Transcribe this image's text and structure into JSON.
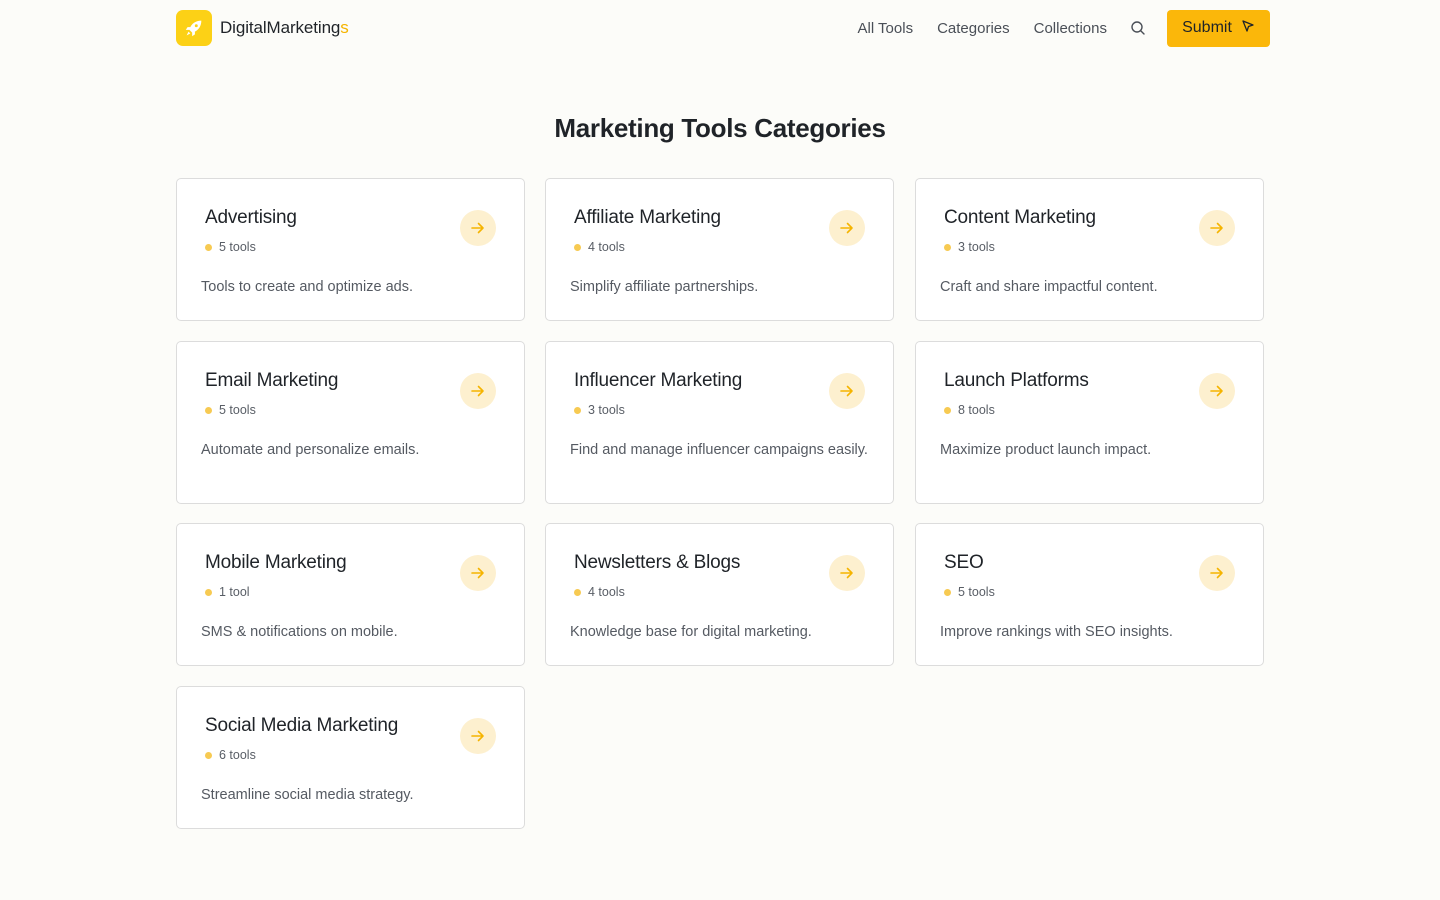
{
  "header": {
    "brand_main": "DigitalMarketing",
    "brand_suffix": "s",
    "nav": [
      "All Tools",
      "Categories",
      "Collections"
    ],
    "submit_label": "Submit"
  },
  "page_title": "Marketing Tools Categories",
  "colors": {
    "accent": "#fbb70a",
    "logo_bg": "#fcd116",
    "dot": "#f7ca52",
    "arrow_bg": "#fdf0cf",
    "arrow": "#f5b400"
  },
  "categories": [
    {
      "title": "Advertising",
      "count": "5 tools",
      "desc": "Tools to create and optimize ads."
    },
    {
      "title": "Affiliate Marketing",
      "count": "4 tools",
      "desc": "Simplify affiliate partnerships."
    },
    {
      "title": "Content Marketing",
      "count": "3 tools",
      "desc": "Craft and share impactful content."
    },
    {
      "title": "Email Marketing",
      "count": "5 tools",
      "desc": "Automate and personalize emails."
    },
    {
      "title": "Influencer Marketing",
      "count": "3 tools",
      "desc": "Find and manage influencer campaigns easily."
    },
    {
      "title": "Launch Platforms",
      "count": "8 tools",
      "desc": "Maximize product launch impact."
    },
    {
      "title": "Mobile Marketing",
      "count": "1 tool",
      "desc": "SMS & notifications on mobile."
    },
    {
      "title": "Newsletters & Blogs",
      "count": "4 tools",
      "desc": "Knowledge base for digital marketing."
    },
    {
      "title": "SEO",
      "count": "5 tools",
      "desc": "Improve rankings with SEO insights."
    },
    {
      "title": "Social Media Marketing",
      "count": "6 tools",
      "desc": "Streamline social media strategy."
    }
  ]
}
